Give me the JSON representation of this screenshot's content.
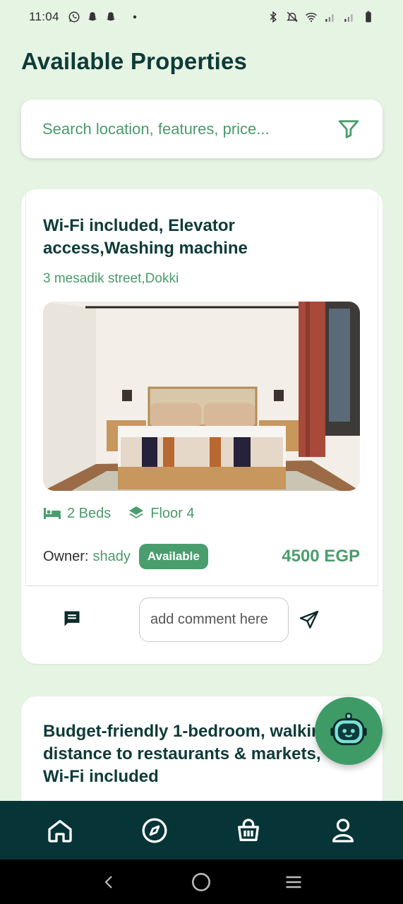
{
  "status_bar": {
    "time": "11:04"
  },
  "page": {
    "title": "Available Properties"
  },
  "search": {
    "placeholder": "Search location, features, price..."
  },
  "listings": [
    {
      "title_line1": "Wi-Fi included, Elevator",
      "title_line2": "access,Washing machine",
      "address": "3 mesadik street,Dokki",
      "beds": "2 Beds",
      "floor": "Floor 4",
      "owner_label": "Owner:",
      "owner_name": "shady",
      "status": "Available",
      "price": "4500 EGP",
      "comment_placeholder": "add comment here"
    },
    {
      "title_line1": "Budget-friendly 1-bedroom, walking",
      "title_line2": "distance to restaurants & markets,",
      "title_line3": "Wi-Fi included"
    }
  ],
  "bottom_nav": [
    {
      "icon": "home-icon"
    },
    {
      "icon": "compass-icon"
    },
    {
      "icon": "basket-icon"
    },
    {
      "icon": "user-icon"
    }
  ],
  "colors": {
    "background": "#e6f4e4",
    "title": "#0d3b38",
    "accent": "#4a9e6d",
    "nav_bg": "#063437"
  }
}
